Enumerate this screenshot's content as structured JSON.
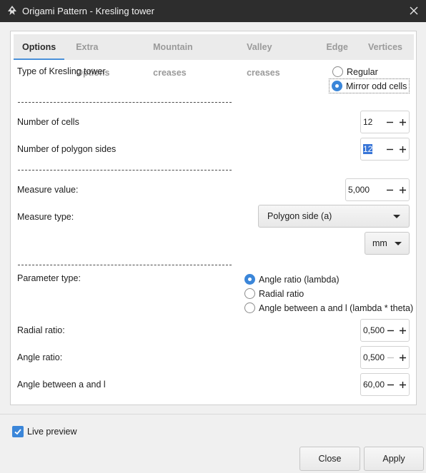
{
  "window": {
    "title": "Origami Pattern - Kresling tower",
    "app_icon": "inkscape-icon",
    "close_icon": "close-icon"
  },
  "tabs": [
    {
      "label": "Options",
      "active": true
    },
    {
      "label": "Extra Options",
      "active": false
    },
    {
      "label": "Mountain creases",
      "active": false
    },
    {
      "label": "Valley creases",
      "active": false
    },
    {
      "label": "Edge",
      "active": false
    },
    {
      "label": "Vertices",
      "active": false
    }
  ],
  "options": {
    "tower_type": {
      "label": "Type of Kresling tower",
      "choices": [
        {
          "label": "Regular",
          "selected": false
        },
        {
          "label": "Mirror odd cells",
          "selected": true
        }
      ]
    },
    "num_cells": {
      "label": "Number of cells",
      "value": "12"
    },
    "num_sides": {
      "label": "Number of polygon sides",
      "value": "12"
    },
    "measure_value": {
      "label": "Measure value:",
      "value": "5,000"
    },
    "measure_type": {
      "label": "Measure type:",
      "selected": "Polygon side (a)"
    },
    "unit": {
      "selected": "mm"
    },
    "parameter_type": {
      "label": "Parameter type:",
      "choices": [
        {
          "label": "Angle ratio (lambda)",
          "selected": true
        },
        {
          "label": "Radial ratio",
          "selected": false
        },
        {
          "label": "Angle between a and l (lambda * theta)",
          "selected": false
        }
      ]
    },
    "radial_ratio": {
      "label": "Radial ratio:",
      "value": "0,500"
    },
    "angle_ratio": {
      "label": "Angle ratio:",
      "value": "0,500"
    },
    "angle_between": {
      "label": "Angle between a and l",
      "value": "60,00"
    }
  },
  "footer": {
    "live_preview": {
      "label": "Live preview",
      "checked": true
    },
    "close_label": "Close",
    "apply_label": "Apply"
  },
  "colors": {
    "accent": "#3b86d9",
    "titlebar": "#2d2d2d"
  }
}
